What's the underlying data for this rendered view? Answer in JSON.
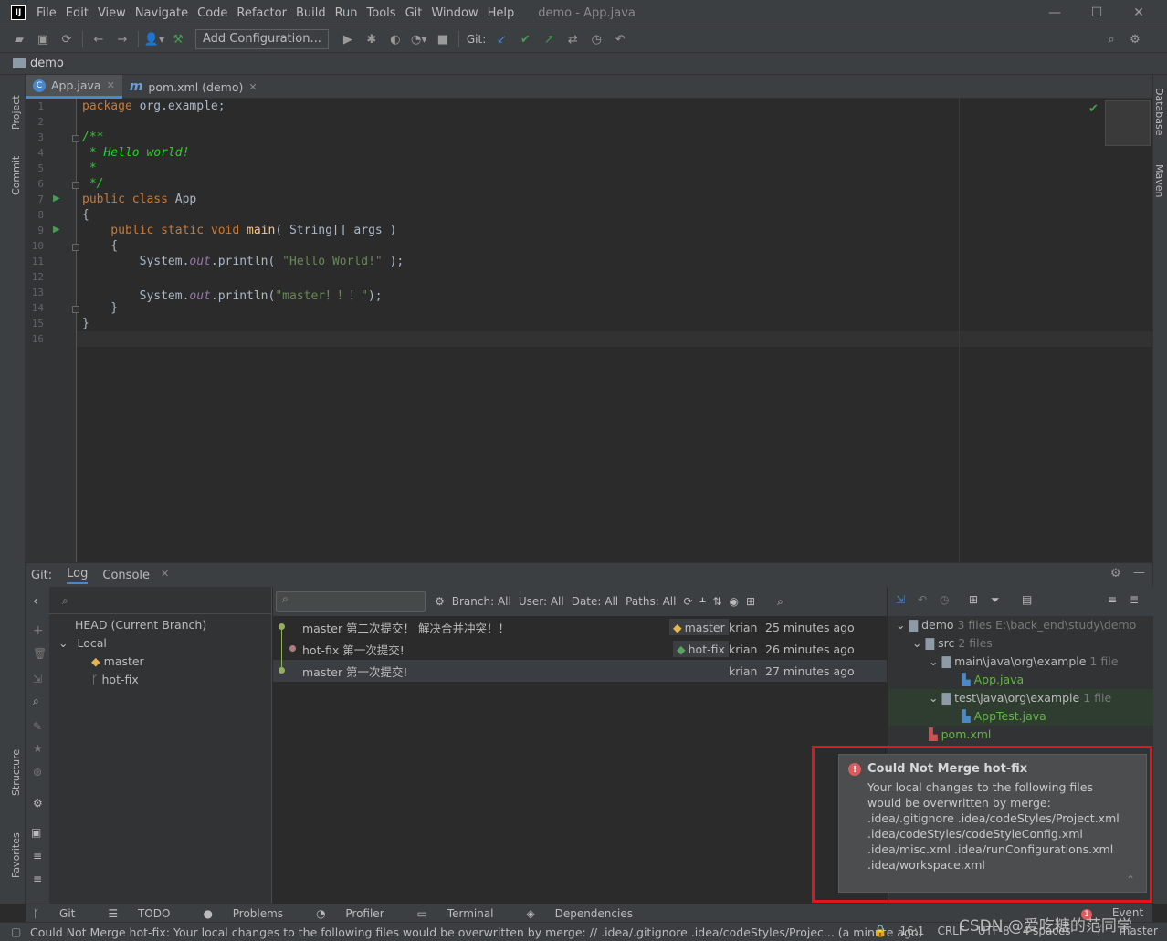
{
  "menu": {
    "items": [
      "File",
      "Edit",
      "View",
      "Navigate",
      "Code",
      "Refactor",
      "Build",
      "Run",
      "Tools",
      "Git",
      "Window",
      "Help"
    ],
    "window_title": "demo - App.java",
    "logo": "IJ"
  },
  "toolbar": {
    "add_config": "Add Configuration...",
    "git_label": "Git:"
  },
  "navbar": {
    "project": "demo"
  },
  "left_strip": {
    "project": "Project",
    "commit": "Commit",
    "structure": "Structure",
    "favorites": "Favorites"
  },
  "right_strip": {
    "database": "Database",
    "maven": "Maven"
  },
  "tabs": [
    {
      "label": "App.java",
      "icon": "class-icon"
    },
    {
      "label": "pom.xml (demo)",
      "icon": "maven-icon"
    }
  ],
  "editor": {
    "line_numbers": [
      "1",
      "2",
      "3",
      "4",
      "5",
      "6",
      "7",
      "8",
      "9",
      "10",
      "11",
      "12",
      "13",
      "14",
      "15",
      "16"
    ],
    "code": {
      "l1a": "package",
      "l1b": " org.example;",
      "l3": "/**",
      "l4": " * Hello world!",
      "l5": " *",
      "l6": " */",
      "l7a": "public class",
      "l7b": " App",
      "l8": "{",
      "l9a": "    public static void",
      "l9b": " main",
      "l9c": "( String[] args )",
      "l10": "    {",
      "l11a": "        System.",
      "l11b": "out",
      "l11c": ".println( ",
      "l11d": "\"Hello World!\"",
      "l11e": " );",
      "l13a": "        System.",
      "l13b": "out",
      "l13c": ".println(",
      "l13d": "\"master！！！\"",
      "l13e": ");",
      "l14": "    }",
      "l15": "}"
    }
  },
  "git_panel": {
    "label": "Git:",
    "tabs": [
      "Log",
      "Console"
    ],
    "branches": {
      "head": "HEAD (Current Branch)",
      "local": "Local",
      "items": [
        "master",
        "hot-fix"
      ]
    },
    "filters": {
      "branch": "Branch: All",
      "user": "User: All",
      "date": "Date: All",
      "paths": "Paths: All"
    },
    "commits": [
      {
        "message": "master 第二次提交！ 解决合并冲突！！",
        "tag": "master",
        "author": "krian",
        "time": "25 minutes ago"
      },
      {
        "message": "hot-fix 第一次提交!",
        "tag": "hot-fix",
        "author": "krian",
        "time": "26 minutes ago"
      },
      {
        "message": "master 第一次提交!",
        "tag": "",
        "author": "krian",
        "time": "27 minutes ago"
      }
    ],
    "changes": {
      "root": "demo",
      "root_info": "3 files  E:\\back_end\\study\\demo",
      "src": "src",
      "src_info": "2 files",
      "main": "main\\java\\org\\example",
      "main_info": "1 file",
      "app": "App.java",
      "test": "test\\java\\org\\example",
      "test_info": "1 file",
      "apptest": "AppTest.java",
      "pom": "pom.xml"
    }
  },
  "notification": {
    "title": "Could Not Merge hot-fix",
    "lines": [
      "Your local changes to the following files",
      "would be overwritten by merge:",
      ".idea/.gitignore .idea/codeStyles/Project.xml",
      ".idea/codeStyles/codeStyleConfig.xml",
      ".idea/misc.xml .idea/runConfigurations.xml",
      ".idea/workspace.xml"
    ]
  },
  "bottom_tabs": [
    "Git",
    "TODO",
    "Problems",
    "Profiler",
    "Terminal",
    "Dependencies"
  ],
  "event_log": {
    "count": "1",
    "label": "Event Log"
  },
  "status": {
    "message": "Could Not Merge hot-fix: Your local changes to the following files would be overwritten by merge: // .idea/.gitignore .idea/codeStyles/Projec... (a minute ago)",
    "position": "16:1",
    "line_sep": "CRLF",
    "encoding": "UTF-8",
    "indent": "4 spaces",
    "branch": "master"
  },
  "watermark": "CSDN @爱吃糖的范同学"
}
